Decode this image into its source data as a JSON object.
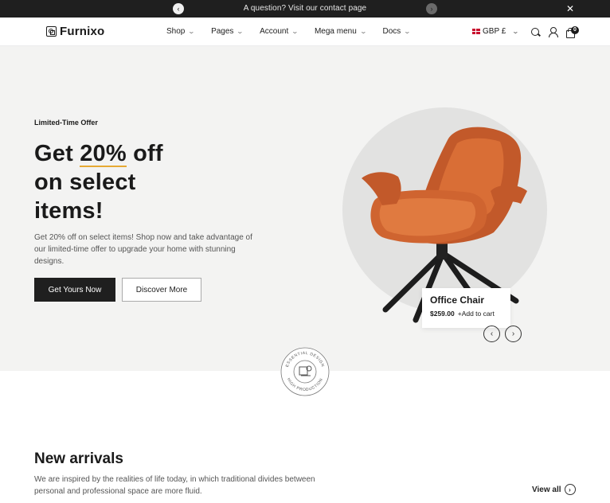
{
  "topbar": {
    "message": "A question? Visit our contact page",
    "prev_icon": "chevron-left-icon",
    "next_icon": "chevron-right-icon",
    "close_glyph": "✕"
  },
  "header": {
    "brand": "Furnixo",
    "nav": [
      "Shop",
      "Pages",
      "Account",
      "Mega menu",
      "Docs"
    ],
    "currency": "GBP £",
    "cart_count": "0"
  },
  "hero": {
    "eyebrow": "Limited-Time Offer",
    "headline_pre": "Get ",
    "headline_accent": "20%",
    "headline_post": " off",
    "headline_line2": "on select",
    "headline_line3": "items!",
    "description": "Get 20% off on select items! Shop now and take advantage of our limited-time offer to upgrade your home with stunning designs.",
    "primary_button": "Get Yours Now",
    "secondary_button": "Discover More",
    "accent_color": "#e6a933",
    "product": {
      "name": "Office Chair",
      "price": "$259.00",
      "add_to_cart": "+Add to cart",
      "color": "#d2652f"
    }
  },
  "badge": {
    "top_text": "ESSENTIAL DESIGN",
    "bottom_text": "HIGH PRODUCTION"
  },
  "arrivals": {
    "title": "New arrivals",
    "description": "We are inspired by the realities of life today, in which traditional divides between personal and professional space are more fluid.",
    "view_all": "View all"
  }
}
